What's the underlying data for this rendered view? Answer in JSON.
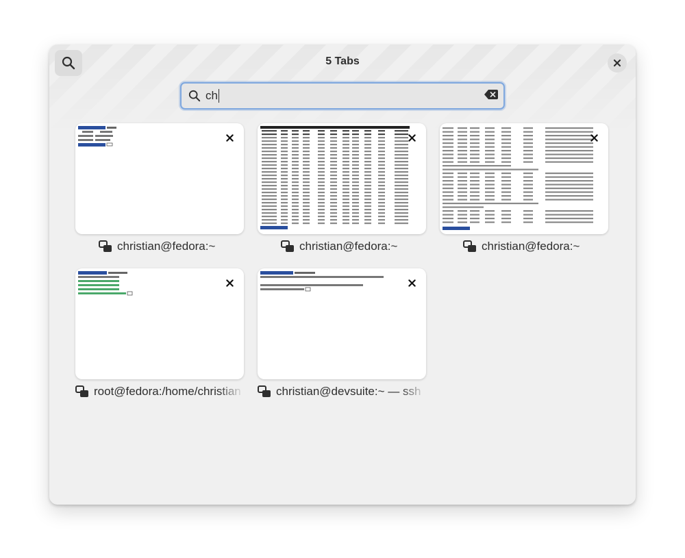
{
  "header": {
    "title": "5 Tabs",
    "search_toggle_icon": "search-icon",
    "close_icon": "close-icon"
  },
  "search": {
    "value": "ch",
    "icon": "search-icon",
    "clear_icon": "edit-clear-icon",
    "accent_color": "#7ea7de"
  },
  "tabs": [
    {
      "title": "christian@fedora:~",
      "icon": "terminal-icon",
      "preview": "shell"
    },
    {
      "title": "christian@fedora:~",
      "icon": "terminal-icon",
      "preview": "top"
    },
    {
      "title": "christian@fedora:~",
      "icon": "terminal-icon",
      "preview": "netstat"
    },
    {
      "title": "root@fedora:/home/christian",
      "icon": "terminal-icon",
      "preview": "sudo"
    },
    {
      "title": "christian@devsuite:~ — ssh",
      "icon": "terminal-icon",
      "preview": "ssh"
    }
  ]
}
